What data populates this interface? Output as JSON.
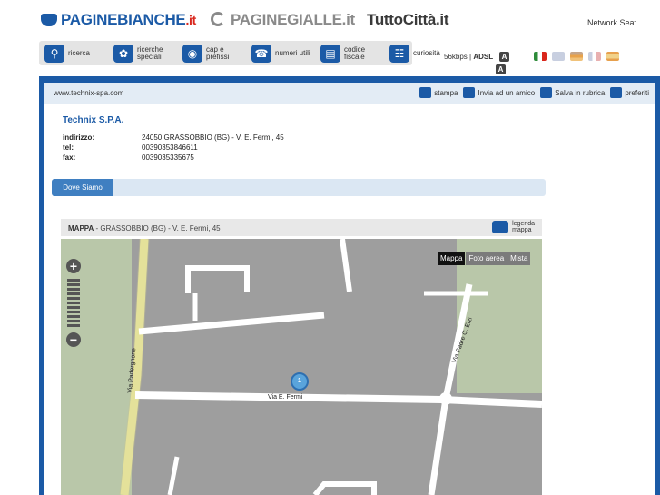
{
  "header": {
    "logo_pb_main": "PAGINEBIANCHE",
    "logo_pb_it": ".it",
    "logo_pg": "PAGINEGIALLE.it",
    "logo_tc": "TuttoCittà.it",
    "network": "Network Seat"
  },
  "nav": [
    {
      "label": "ricerca",
      "icon": "search-icon"
    },
    {
      "label": "ricerche speciali",
      "icon": "puzzle-icon"
    },
    {
      "label": "cap e prefissi",
      "icon": "globe-icon"
    },
    {
      "label": "numeri utili",
      "icon": "phone-icon"
    },
    {
      "label": "codice fiscale",
      "icon": "id-card-icon"
    },
    {
      "label": "curiosità",
      "icon": "book-icon"
    }
  ],
  "connection": {
    "speed": "56kbps",
    "type": "ADSL",
    "badge1": "A",
    "badge2": "A"
  },
  "languages": [
    {
      "name": "italian",
      "color": "#2e8b3a"
    },
    {
      "name": "english",
      "color": "#c8cfe0"
    },
    {
      "name": "german",
      "color": "#e8a24a"
    },
    {
      "name": "french",
      "color": "#c8cfe0"
    },
    {
      "name": "spanish",
      "color": "#e7a04d"
    }
  ],
  "urlbar": {
    "url": "www.technix-spa.com",
    "actions": [
      "stampa",
      "Invia ad un amico",
      "Salva in rubrica",
      "preferiti"
    ]
  },
  "company": {
    "name": "Technix S.P.A.",
    "fields": [
      {
        "key": "indirizzo:",
        "value": "24050 GRASSOBBIO (BG) - V. E. Fermi, 45"
      },
      {
        "key": "tel:",
        "value": "00390353846611"
      },
      {
        "key": "fax:",
        "value": "0039035335675"
      }
    ]
  },
  "tabs": {
    "active": "Dove Siamo"
  },
  "map": {
    "title": "MAPPA",
    "subtitle": "GRASSOBBIO (BG) - V. E. Fermi, 45",
    "legend_line1": "legenda",
    "legend_line2": "mappa",
    "types": [
      "Mappa",
      "Foto aerea",
      "Mista"
    ],
    "streets": {
      "s1": "Via Padergnone",
      "s2": "Via E. Fermi",
      "s3": "Via Padre C. Elzi"
    },
    "marker": "1"
  }
}
